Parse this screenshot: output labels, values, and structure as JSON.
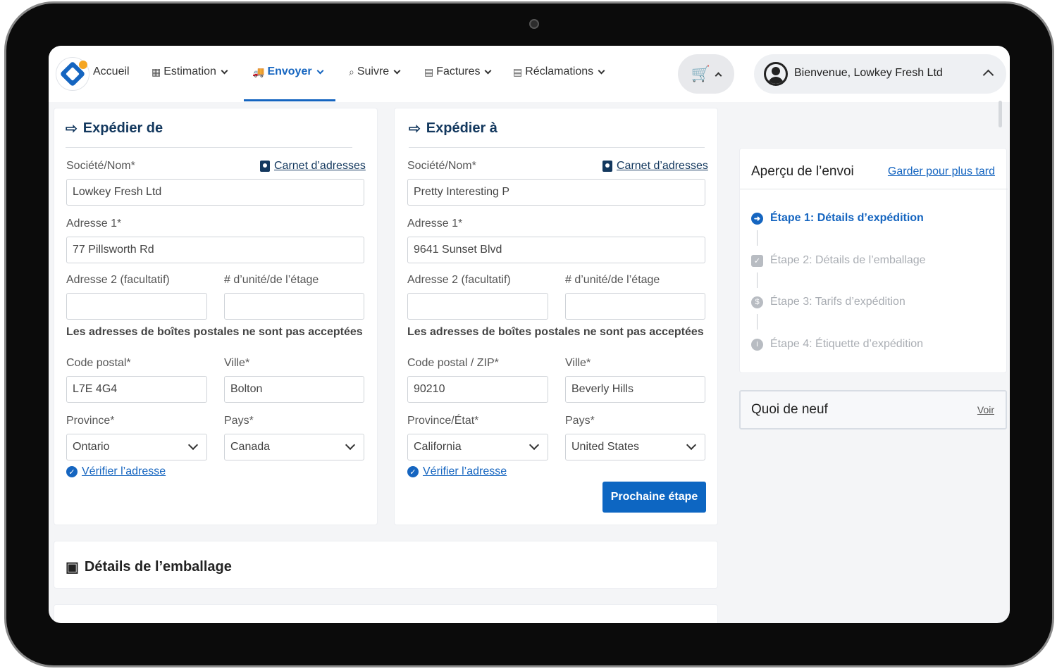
{
  "nav": {
    "items": [
      {
        "label": "Accueil",
        "icon": "home",
        "has_menu": false
      },
      {
        "label": "Estimation",
        "icon": "calculator-icon",
        "has_menu": true
      },
      {
        "label": "Envoyer",
        "icon": "truck-icon",
        "has_menu": true,
        "active": true
      },
      {
        "label": "Suivre",
        "icon": "search-icon",
        "has_menu": true
      },
      {
        "label": "Factures",
        "icon": "invoice-icon",
        "has_menu": true
      },
      {
        "label": "Réclamations",
        "icon": "claim-icon",
        "has_menu": true
      }
    ],
    "user_greeting": "Bienvenue, Lowkey Fresh Ltd"
  },
  "ship_from": {
    "title": "Expédier de",
    "company_label": "Société/Nom*",
    "address_book": "Carnet d’adresses",
    "company": "Lowkey Fresh Ltd",
    "address1_label": "Adresse 1*",
    "address1": "77 Pillsworth Rd",
    "address2_label": "Adresse 2 (facultatif)",
    "address2": "",
    "unit_label": "# d’unité/de l’étage",
    "unit": "",
    "po_note": "Les adresses de boîtes postales ne sont pas acceptées",
    "postal_label": "Code postal*",
    "postal": "L7E 4G4",
    "city_label": "Ville*",
    "city": "Bolton",
    "province_label": "Province*",
    "province": "Ontario",
    "country_label": "Pays*",
    "country": "Canada",
    "verify": "Vérifier l’adresse"
  },
  "ship_to": {
    "title": "Expédier à",
    "company_label": "Société/Nom*",
    "address_book": "Carnet d’adresses",
    "company": "Pretty Interesting P",
    "address1_label": "Adresse 1*",
    "address1": "9641 Sunset Blvd",
    "address2_label": "Adresse 2 (facultatif)",
    "address2": "",
    "unit_label": "# d’unité/de l’étage",
    "unit": "",
    "po_note": "Les adresses de boîtes postales ne sont pas acceptées",
    "postal_label": "Code postal / ZIP*",
    "postal": "90210",
    "city_label": "Ville*",
    "city": "Beverly Hills",
    "province_label": "Province/État*",
    "province": "California",
    "country_label": "Pays*",
    "country": "United States",
    "verify": "Vérifier l’adresse",
    "next_button": "Prochaine étape"
  },
  "packaging": {
    "title": "Détails de l’emballage"
  },
  "summary": {
    "title": "Aperçu de l’envoi",
    "save_later": "Garder pour plus tard",
    "steps": [
      {
        "label": "Étape 1: Détails d’expédition",
        "active": true
      },
      {
        "label": "Étape 2: Détails de l’emballage",
        "active": false
      },
      {
        "label": "Étape 3: Tarifs d’expédition",
        "active": false
      },
      {
        "label": "Étape 4: Étiquette d’expédition",
        "active": false
      }
    ]
  },
  "news": {
    "title": "Quoi de neuf",
    "link": "Voir"
  },
  "colors": {
    "primary": "#1565c0",
    "heading": "#13385e",
    "button": "#0d66c2",
    "inactive_step": "#a9adb3"
  }
}
